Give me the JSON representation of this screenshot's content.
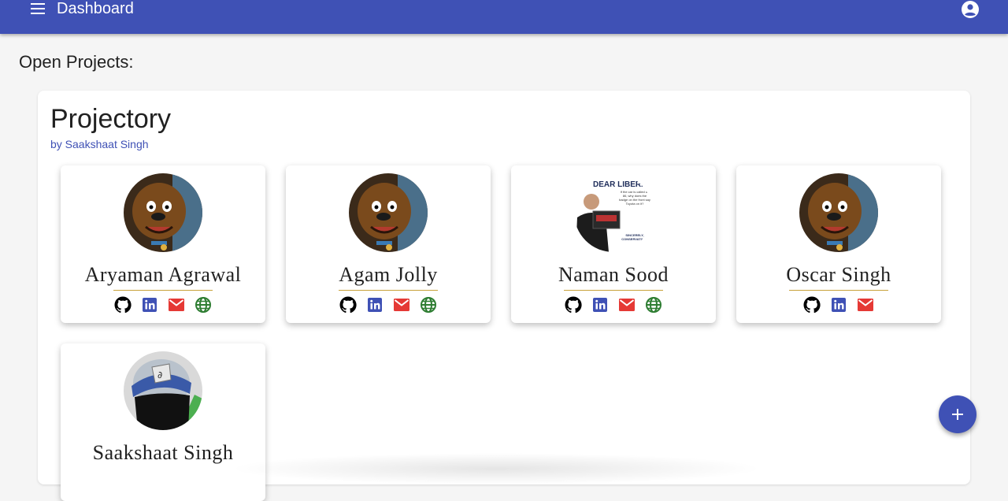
{
  "appbar": {
    "title": "Dashboard",
    "menu_icon": "menu-icon",
    "account_icon": "account-circle-icon",
    "color": "#3f51b5"
  },
  "section": {
    "title": "Open Projects:"
  },
  "project": {
    "title": "Projectory",
    "author": "by Saakshaat Singh",
    "members": [
      {
        "name": "Aryaman Agrawal",
        "avatar": "cartoon-dog-avatar",
        "links": [
          "github-icon",
          "linkedin-icon",
          "email-icon",
          "website-icon"
        ]
      },
      {
        "name": "Agam Jolly",
        "avatar": "cartoon-dog-avatar",
        "links": [
          "github-icon",
          "linkedin-icon",
          "email-icon",
          "website-icon"
        ]
      },
      {
        "name": "Naman Sood",
        "avatar": "meme-photo-avatar",
        "meme_heading": "DEAR LIBERA",
        "meme_body": "If the car is called an 86, why does the badge on the front say Toyota on it?",
        "meme_signoff": "SINCERELY, CONSERVATIVES",
        "links": [
          "github-icon",
          "linkedin-icon",
          "email-icon",
          "website-icon"
        ]
      },
      {
        "name": "Oscar Singh",
        "avatar": "cartoon-dog-avatar",
        "links": [
          "github-icon",
          "linkedin-icon",
          "email-icon"
        ]
      },
      {
        "name": "Saakshaat Singh",
        "avatar": "masked-ninja-photo-avatar",
        "links": []
      }
    ]
  },
  "fab": {
    "icon": "add-icon"
  },
  "colors": {
    "accent": "#3f51b5",
    "email": "#e53935",
    "website": "#2e7d32",
    "rule": "#c8a23a"
  }
}
